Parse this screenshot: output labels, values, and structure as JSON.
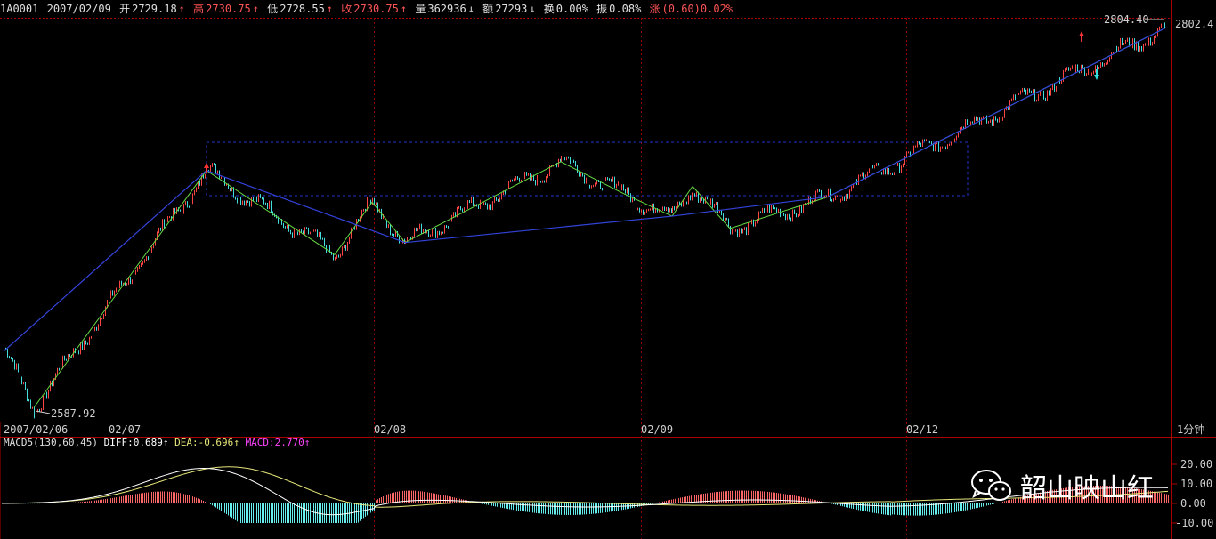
{
  "header": {
    "code": "1A0001",
    "date": "2007/02/09",
    "open_label": "开",
    "open": "2729.18",
    "high_label": "高",
    "high": "2730.75",
    "low_label": "低",
    "low": "2728.55",
    "close_label": "收",
    "close": "2730.75",
    "volume_label": "量",
    "volume": "362936",
    "amount_label": "额",
    "amount": "27293",
    "turnover_label": "换",
    "turnover": "0.00%",
    "amplitude_label": "振",
    "amplitude": "0.08%",
    "change_label": "涨",
    "change": "(0.60)0.02%",
    "up_arrow": "↑",
    "down_arrow": "↓"
  },
  "price_labels": {
    "low_marker": "2587.92",
    "high_marker": "2804.40",
    "right_price": "2802.4"
  },
  "x_axis": {
    "labels": [
      "2007/02/06",
      "02/07",
      "02/08",
      "02/09",
      "02/12"
    ],
    "period": "1分钟"
  },
  "macd": {
    "name": "MACD5(130,60,45)",
    "diff_label": "DIFF:0.689",
    "diff_arrow": "↑",
    "dea_label": "DEA:-0.696",
    "dea_arrow": "↑",
    "macd_label": "MACD:2.770",
    "macd_arrow": "↑",
    "y_ticks": [
      "20.00",
      "10.00",
      "0.00",
      "-10.00"
    ]
  },
  "watermark": {
    "text": "韶山映山红",
    "icon": "wechat-icon"
  },
  "colors": {
    "background": "#000000",
    "border": "#aa0000",
    "up": "#ff4444",
    "down": "#44dddd",
    "zigzag": "#66dd44",
    "trendline": "#3344dd",
    "box": "#2233cc",
    "diff": "#ffffff",
    "dea": "#e6e67a"
  },
  "chart_data": {
    "type": "line",
    "title": "",
    "x_tick_labels": [
      "2007/02/06",
      "02/07",
      "02/08",
      "02/09",
      "02/12"
    ],
    "y_price_labels": [
      2587.92,
      2804.4,
      2802.4
    ],
    "zigzag_points": [
      {
        "x": "02/06 open",
        "y": 2620
      },
      {
        "x": "02/06 low",
        "y": 2587.92
      },
      {
        "x": "02/07 peak",
        "y": 2723
      },
      {
        "x": "02/07 trough",
        "y": 2675
      },
      {
        "x": "02/08 rebound",
        "y": 2705
      },
      {
        "x": "02/08 low",
        "y": 2682
      },
      {
        "x": "02/08 peak",
        "y": 2728
      },
      {
        "x": "02/09 mid",
        "y": 2710
      },
      {
        "x": "02/09 dip",
        "y": 2697
      },
      {
        "x": "02/09 bounce",
        "y": 2714
      },
      {
        "x": "02/09 low",
        "y": 2690
      },
      {
        "x": "02/09 close",
        "y": 2708
      },
      {
        "x": "02/12 close",
        "y": 2804.4
      }
    ],
    "macd_series": [
      {
        "name": "DIFF",
        "last": 0.689
      },
      {
        "name": "DEA",
        "last": -0.696
      },
      {
        "name": "MACD",
        "last": 2.77
      }
    ],
    "macd_ylim": [
      -15,
      25
    ]
  }
}
